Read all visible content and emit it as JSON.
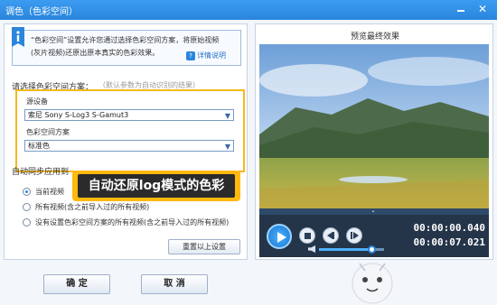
{
  "window": {
    "title": "调色（色彩空间）",
    "minimize_icon": "minimize-icon",
    "close_label": "✕"
  },
  "info": {
    "text_line1": "“色彩空间”设置允许您通过选择色彩空间方案，将原始视频",
    "text_line2": "(灰片视频)还原出原本真实的色彩效果。",
    "help_label": "详情说明",
    "help_icon_label": "?"
  },
  "color_space": {
    "section_label": "请选择色彩空间方案：",
    "section_hint": "（默认参数为自动识别的结果）",
    "source_device_label": "源设备",
    "source_device_value": "索尼 Sony S-Log3 S-Gamut3",
    "scheme_label": "色彩空间方案",
    "scheme_value": "标准色"
  },
  "sync": {
    "label": "自动同步应用到",
    "options": [
      {
        "label": "当前视频",
        "selected": true
      },
      {
        "label": "所有视频(含之前导入过的所有视频)",
        "selected": false
      },
      {
        "label": "没有设置色彩空间方案的所有视频(含之前导入过的所有视频)",
        "selected": false
      }
    ],
    "reset_label": "重置以上设置"
  },
  "callout": {
    "text": "自动还原log模式的色彩"
  },
  "buttons": {
    "ok_label": "确  定",
    "cancel_label": "取  消"
  },
  "preview": {
    "title": "预览最终效果",
    "current_time": "00:00:00.040",
    "total_time": "00:00:07.021",
    "volume_level": 0.8,
    "progress_notch_label": "⌄"
  },
  "colors": {
    "accent": "#2a85dc",
    "highlight": "#f5b91b",
    "callout_bg": "#2b2b2b",
    "player_bg": "#253549"
  }
}
